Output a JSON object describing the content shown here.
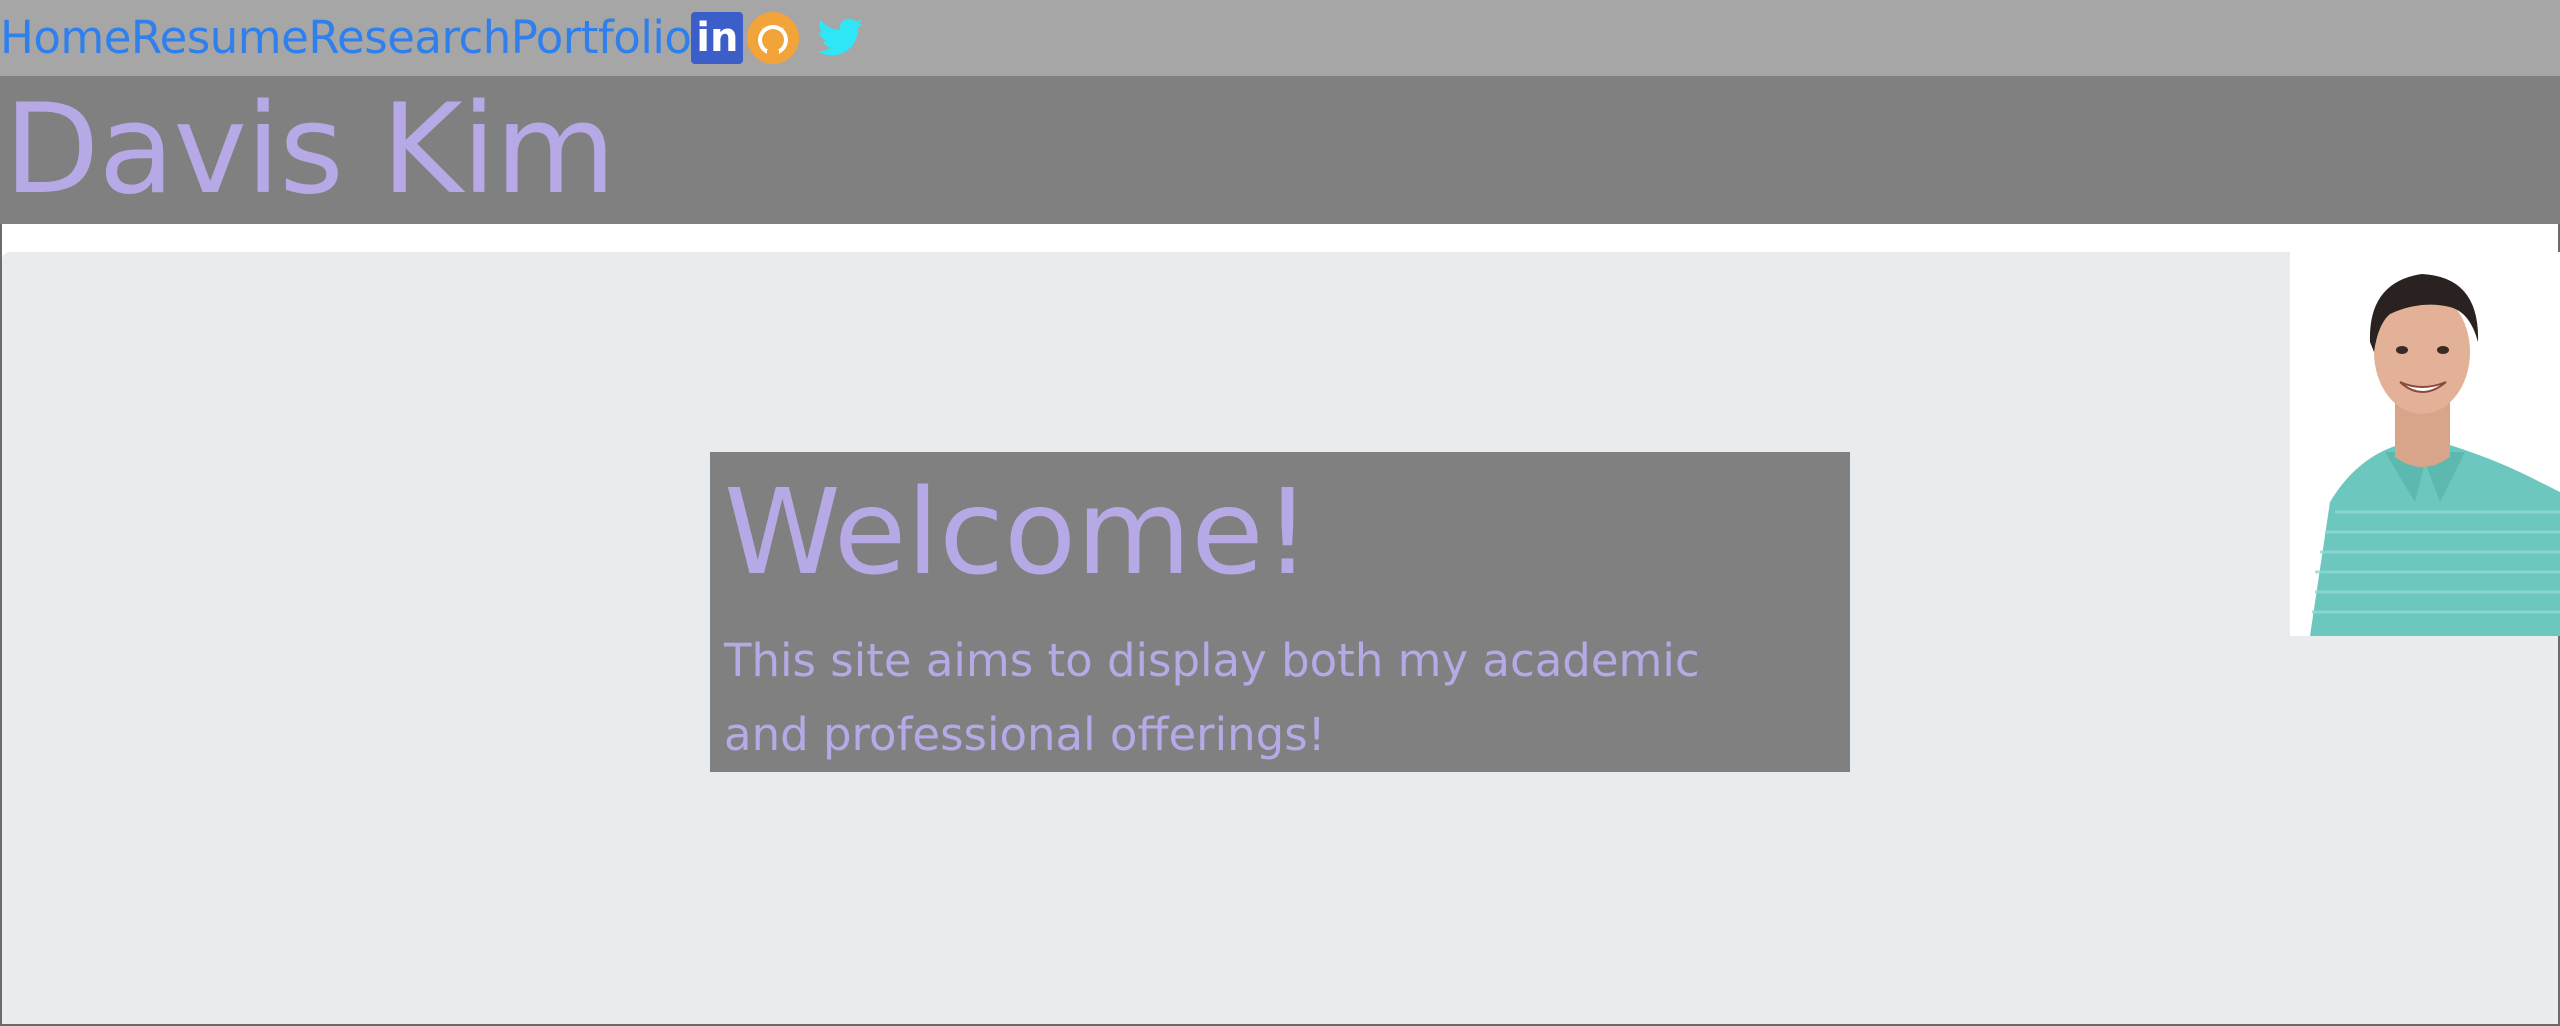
{
  "nav": {
    "links": [
      "Home",
      "Resume",
      "Research",
      "Portfolio"
    ],
    "linkedin_label": "in"
  },
  "header": {
    "name": "Davis Kim"
  },
  "welcome": {
    "title": "Welcome!",
    "text": "This site aims to display both my academic and professional offerings!"
  },
  "colors": {
    "nav_bg": "#a6a6a6",
    "nav_link": "#2f80ed",
    "header_bg": "#808080",
    "accent_text": "#b6a9e6",
    "panel_bg": "#e8ecef",
    "linkedin": "#3b5ec9",
    "github": "#f2a33a",
    "twitter": "#2ee6f5"
  },
  "icons": [
    "linkedin-icon",
    "github-icon",
    "twitter-icon"
  ]
}
